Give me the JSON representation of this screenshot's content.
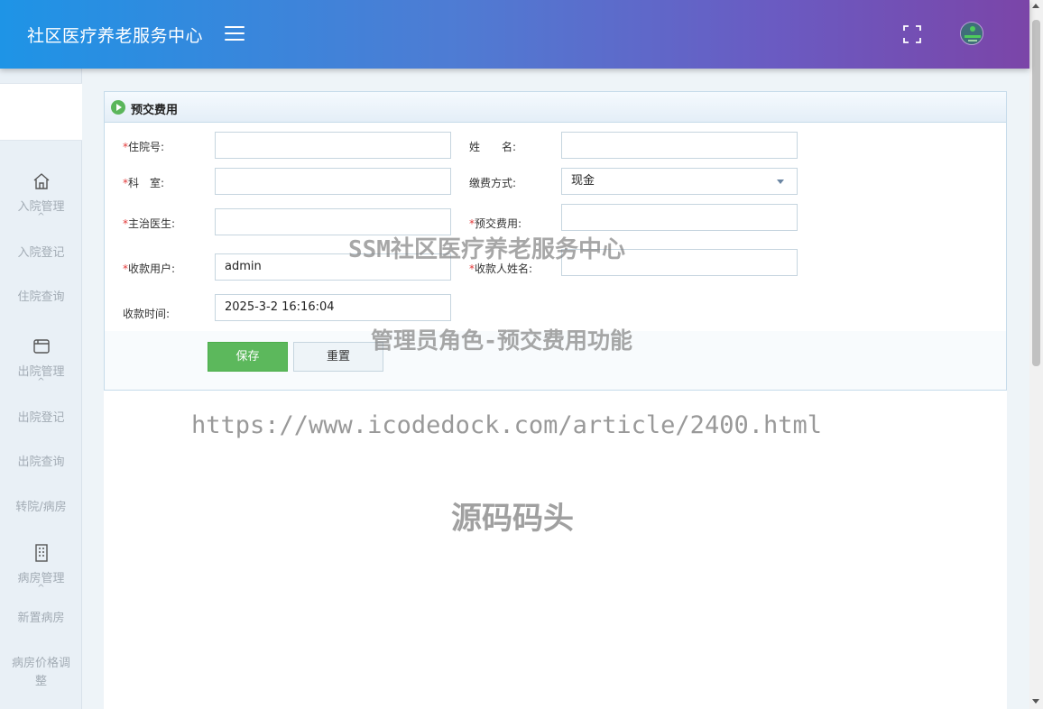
{
  "header": {
    "title": "社区医疗养老服务中心",
    "menu_icon": "hamburger-icon",
    "fullscreen_icon": "fullscreen-icon",
    "avatar_icon": "avatar"
  },
  "sidebar": {
    "groups": [
      {
        "label": "入院管理",
        "icon": "home-icon",
        "items": [
          "入院登记",
          "住院查询"
        ]
      },
      {
        "label": "出院管理",
        "icon": "window-icon",
        "items": [
          "出院登记",
          "出院查询",
          "转院/病房"
        ]
      },
      {
        "label": "病房管理",
        "icon": "building-icon",
        "items": [
          "新置病房",
          "病房价格调整"
        ]
      }
    ],
    "caret": "^"
  },
  "panel": {
    "title": "预交费用",
    "required_mark": "*",
    "fields": {
      "admission_no": {
        "label": "住院号:",
        "value": ""
      },
      "name": {
        "label": "姓　　名:",
        "value": ""
      },
      "department": {
        "label": "科　室:",
        "value": ""
      },
      "payment_method": {
        "label": "缴费方式:",
        "value": "现金"
      },
      "doctor": {
        "label": "主治医生:",
        "value": ""
      },
      "prepaid_fee": {
        "label": "预交费用:",
        "value": ""
      },
      "payee_user": {
        "label": "收款用户:",
        "value": "admin"
      },
      "payee_name": {
        "label": "收款人姓名:",
        "value": ""
      },
      "payment_time": {
        "label": "收款时间:",
        "value": "2025-3-2 16:16:04"
      }
    },
    "save_label": "保存",
    "reset_label": "重置"
  },
  "watermarks": [
    "SSM社区医疗养老服务中心",
    "管理员角色-预交费用功能",
    "https://www.icodedock.com/article/2400.html",
    "源码码头"
  ],
  "colors": {
    "header_gradient_start": "#1e94e6",
    "header_gradient_end": "#7b45a8",
    "save_button": "#5cb85c",
    "required": "#e23a3a"
  }
}
